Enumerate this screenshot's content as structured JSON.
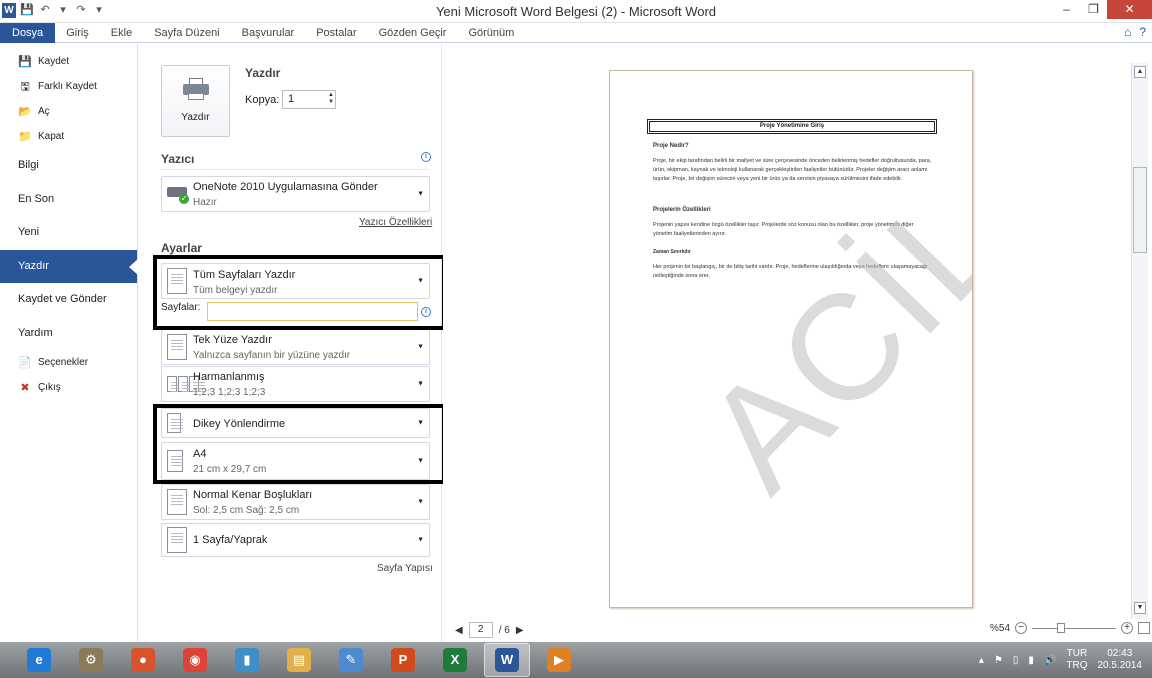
{
  "window": {
    "title": "Yeni Microsoft Word Belgesi (2) - Microsoft Word",
    "logo_letter": "W",
    "qat": [
      "💾",
      "↶",
      "▾",
      "↷",
      "▾"
    ],
    "controls": {
      "minimize": "–",
      "maximize": "❐",
      "close": "✕"
    }
  },
  "ribbon": {
    "tabs": [
      "Dosya",
      "Giriş",
      "Ekle",
      "Sayfa Düzeni",
      "Başvurular",
      "Postalar",
      "Gözden Geçir",
      "Görünüm"
    ],
    "help_icons": [
      "⌂",
      "?"
    ]
  },
  "nav": {
    "small_items": [
      {
        "label": "Kaydet",
        "icon": "💾"
      },
      {
        "label": "Farklı Kaydet",
        "icon": "🖫"
      },
      {
        "label": "Aç",
        "icon": "📂"
      },
      {
        "label": "Kapat",
        "icon": "📁"
      }
    ],
    "big_items": [
      "Bilgi",
      "En Son",
      "Yeni",
      "Yazdır",
      "Kaydet ve Gönder",
      "Yardım"
    ],
    "bottom_items": [
      {
        "label": "Seçenekler",
        "icon": "📄"
      },
      {
        "label": "Çıkış",
        "icon": "✖"
      }
    ]
  },
  "print": {
    "button_label": "Yazdır",
    "heading": "Yazdır",
    "copies_label": "Kopya:",
    "copies_value": "1"
  },
  "printer": {
    "heading": "Yazıcı",
    "name": "OneNote 2010 Uygulamasına Gönder",
    "status": "Hazır",
    "properties_link": "Yazıcı Özellikleri"
  },
  "settings": {
    "heading": "Ayarlar",
    "scope_title": "Tüm Sayfaları Yazdır",
    "scope_sub": "Tüm belgeyi yazdır",
    "pages_label": "Sayfalar:",
    "pages_value": "",
    "sides_title": "Tek Yüze Yazdır",
    "sides_sub": "Yalnızca sayfanın bir yüzüne yazdır",
    "collate_title": "Harmanlanmış",
    "collate_sub": "1;2;3    1;2;3    1;2;3",
    "orientation_title": "Dikey Yönlendirme",
    "paper_title": "A4",
    "paper_sub": "21 cm x 29,7 cm",
    "margins_title": "Normal Kenar Boşlukları",
    "margins_sub": "Sol:  2,5 cm    Sağ:  2,5 cm",
    "persheet_title": "1 Sayfa/Yaprak",
    "page_setup_link": "Sayfa Yapısı"
  },
  "preview": {
    "doc_title": "Proje Yönetimine Giriş",
    "h1": "Proje Nedir?",
    "p1": "Proje, bir ekip tarafından belirli bir maliyet ve süre çerçevesinde önceden belirlenmiş hedefler doğrultusunda, para, ürün, ekipman, kaynak ve teknoloji kullanarak gerçekleştirilen faaliyetler bütünüdür. Projeler değişim aracı anlamı taşırlar. Proje, bir değişim sürecini veya yeni bir ürün ya da servisin piyasaya sürülmesini ifade edebilir.",
    "h2": "Projelerin Özellikleri",
    "p2": "Projenin yapısı kendine özgü özellikler taşır. Projelerde söz konusu olan bu özellikler, proje yönetimini diğer yönetim faaliyetlerinden ayırır.",
    "h3": "Zaman Sınırlıdır",
    "p3": "Her projenin bir başlangıç, bir de bitiş tarihi vardır. Proje, hedeflerine ulaşıldığında veya hedeflere ulaşamayacağı netleştiğinde sona erer.",
    "watermark": "ACİL"
  },
  "footer": {
    "page_current": "2",
    "page_total": "/ 6",
    "zoom_percent": "%54",
    "zoom_level": 0.33
  },
  "taskbar": {
    "apps": [
      {
        "name": "ie",
        "glyph": "e",
        "color": "#1f7ad8"
      },
      {
        "name": "tool",
        "glyph": "⚙",
        "color": "#8c7b5a"
      },
      {
        "name": "paint",
        "glyph": "●",
        "color": "#d8542d"
      },
      {
        "name": "chrome",
        "glyph": "◉",
        "color": "#db4437"
      },
      {
        "name": "files",
        "glyph": "▮",
        "color": "#3d8fc7"
      },
      {
        "name": "explorer",
        "glyph": "▤",
        "color": "#e1b04a"
      },
      {
        "name": "paint2",
        "glyph": "✎",
        "color": "#4f8ad1"
      },
      {
        "name": "powerpoint",
        "glyph": "P",
        "color": "#d04a1e"
      },
      {
        "name": "excel",
        "glyph": "X",
        "color": "#1e7b3c"
      },
      {
        "name": "word",
        "glyph": "W",
        "color": "#2b5797"
      },
      {
        "name": "media",
        "glyph": "▶",
        "color": "#e08024"
      }
    ],
    "active_index": 9,
    "lang_top": "TUR",
    "lang_bottom": "TRQ",
    "time": "02:43",
    "date": "20.5.2014"
  }
}
